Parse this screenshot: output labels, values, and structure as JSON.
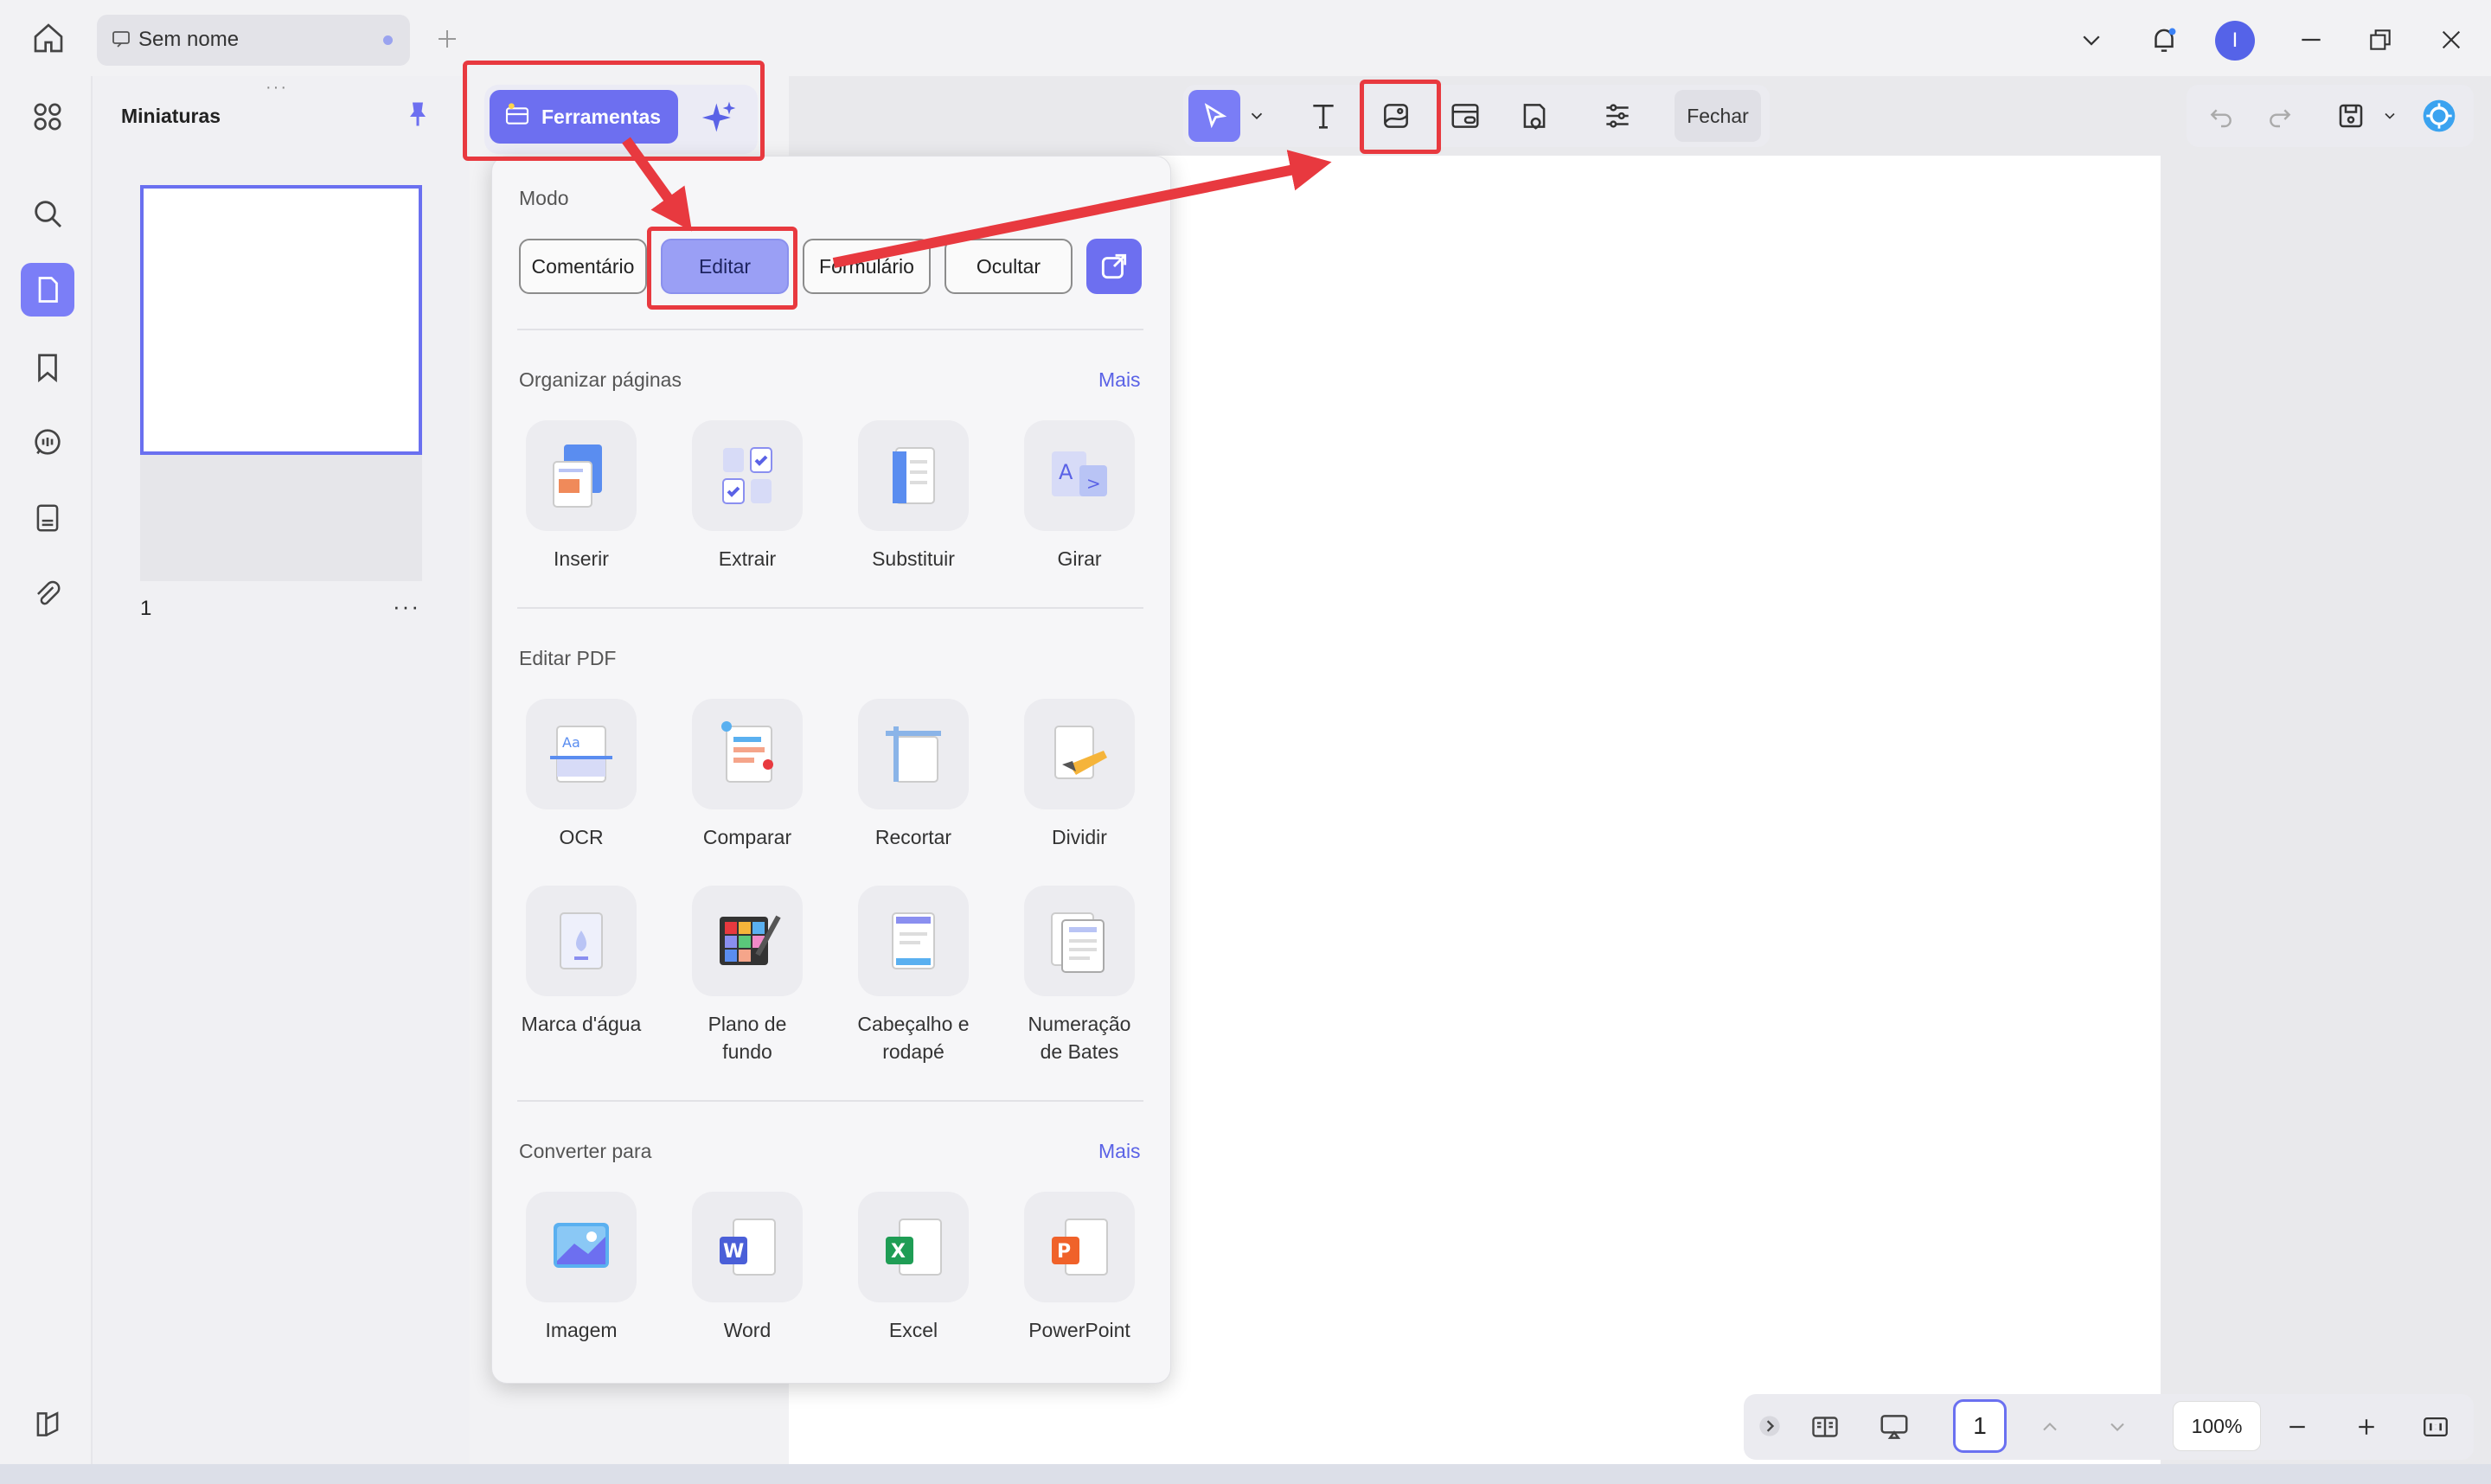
{
  "tab": {
    "title": "Sem nome"
  },
  "user": {
    "initial": "I"
  },
  "thumbnails": {
    "title": "Miniaturas",
    "page_number": "1",
    "more": "···"
  },
  "toolbar": {
    "ferramentas_label": "Ferramentas",
    "fechar_label": "Fechar"
  },
  "panel": {
    "mode_label": "Modo",
    "modes": [
      "Comentário",
      "Editar",
      "Formulário",
      "Ocultar"
    ],
    "active_mode": "Editar",
    "organize": {
      "label": "Organizar páginas",
      "more": "Mais",
      "tools": [
        "Inserir",
        "Extrair",
        "Substituir",
        "Girar"
      ]
    },
    "edit_pdf": {
      "label": "Editar PDF",
      "tools": [
        "OCR",
        "Comparar",
        "Recortar",
        "Dividir",
        "Marca d'água",
        "Plano de fundo",
        "Cabeçalho e rodapé",
        "Numeração de Bates"
      ]
    },
    "convert": {
      "label": "Converter para",
      "more": "Mais",
      "tools": [
        "Imagem",
        "Word",
        "Excel",
        "PowerPoint"
      ]
    }
  },
  "bottom": {
    "page": "1",
    "zoom": "100%"
  },
  "colors": {
    "accent": "#6d6ff0",
    "highlight": "#e8393f",
    "page": "#ffffff"
  }
}
